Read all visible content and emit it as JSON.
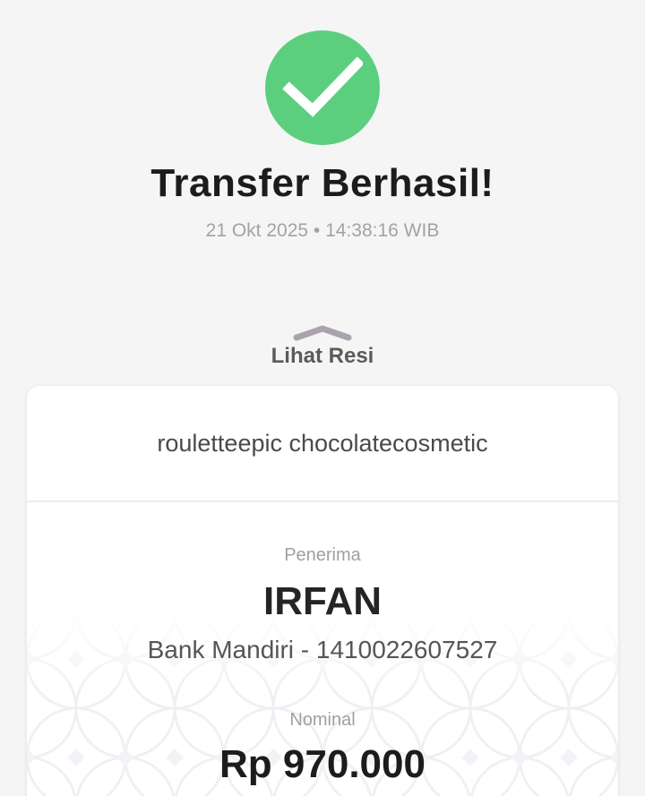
{
  "status": {
    "title": "Transfer Berhasil!",
    "timestamp": "21 Okt 2025 • 14:38:16 WIB",
    "icon": "check-circle-icon",
    "color": "#5ccf7f"
  },
  "receipt_toggle": {
    "label": "Lihat Resi",
    "icon": "chevron-up-icon"
  },
  "receipt": {
    "note": "rouletteepic chocolatecosmetic",
    "recipient_label": "Penerima",
    "recipient_name": "IRFAN",
    "recipient_account": "Bank Mandiri - 1410022607527",
    "amount_label": "Nominal",
    "amount": "Rp 970.000"
  }
}
